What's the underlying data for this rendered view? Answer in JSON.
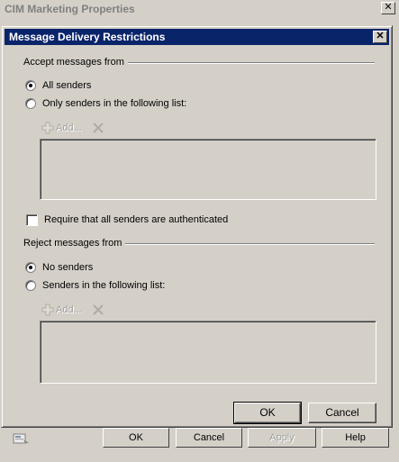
{
  "parent_window": {
    "title": "CIM Marketing Properties",
    "close_glyph": "✕",
    "buttons": {
      "ok": "OK",
      "cancel": "Cancel",
      "apply": "Apply",
      "help": "Help"
    }
  },
  "dialog": {
    "title": "Message Delivery Restrictions",
    "close_glyph": "✕",
    "accept": {
      "group_label": "Accept messages from",
      "option_all": "All senders",
      "option_list": "Only senders in the following list:",
      "selected": "All senders",
      "add_label": "Add..."
    },
    "require_auth_label": "Require that all senders are authenticated",
    "require_auth_checked": false,
    "reject": {
      "group_label": "Reject messages from",
      "option_none": "No senders",
      "option_list": "Senders in the following list:",
      "selected": "No senders",
      "add_label": "Add..."
    },
    "buttons": {
      "ok": "OK",
      "cancel": "Cancel"
    }
  },
  "icons": {
    "add": "plus-add-icon",
    "remove": "x-remove-icon",
    "properties": "properties-icon"
  }
}
